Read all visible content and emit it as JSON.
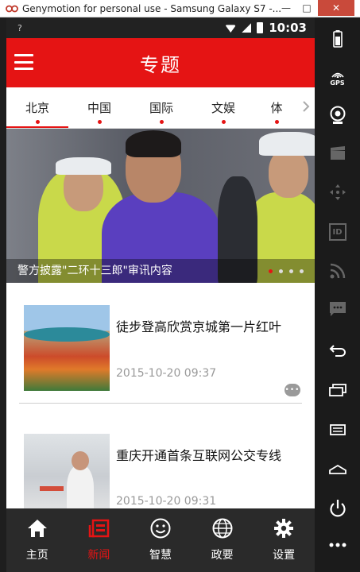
{
  "window": {
    "title": "Genymotion for personal use - Samsung Galaxy S7 -...",
    "minimize": "—",
    "maximize": "□",
    "close": "✕"
  },
  "status_bar": {
    "sim_indicator": "?",
    "time": "10:03"
  },
  "app_bar": {
    "title": "专题",
    "menu_icon": "hamburger-menu-icon"
  },
  "tabs": [
    {
      "label": "北京",
      "active": true
    },
    {
      "label": "中国",
      "active": false
    },
    {
      "label": "国际",
      "active": false
    },
    {
      "label": "文娱",
      "active": false
    },
    {
      "label": "体",
      "active": false
    }
  ],
  "tabs_more_icon": "chevron-right-icon",
  "hero": {
    "caption": "警方披露\"二环十三郎\"审讯内容",
    "page_count": 4,
    "active_page": 1
  },
  "news": [
    {
      "title": "徒步登高欣赏京城第一片红叶",
      "time": "2015-10-20 09:37",
      "has_comment_icon": true
    },
    {
      "title": "重庆开通首条互联网公交专线",
      "time": "2015-10-20 09:31",
      "has_comment_icon": false
    }
  ],
  "bottom_nav": [
    {
      "label": "主页",
      "icon": "home-icon",
      "active": false
    },
    {
      "label": "新闻",
      "icon": "news-icon",
      "active": true
    },
    {
      "label": "智慧",
      "icon": "smiley-icon",
      "active": false
    },
    {
      "label": "政要",
      "icon": "globe-icon",
      "active": false
    },
    {
      "label": "设置",
      "icon": "gear-icon",
      "active": false
    }
  ],
  "side_toolbar": {
    "gps_label": "GPS",
    "id_label": "ID"
  },
  "colors": {
    "accent": "#e51414",
    "nav_bg": "#2a2a2a",
    "toolbar_bg": "#1b1b1b"
  }
}
